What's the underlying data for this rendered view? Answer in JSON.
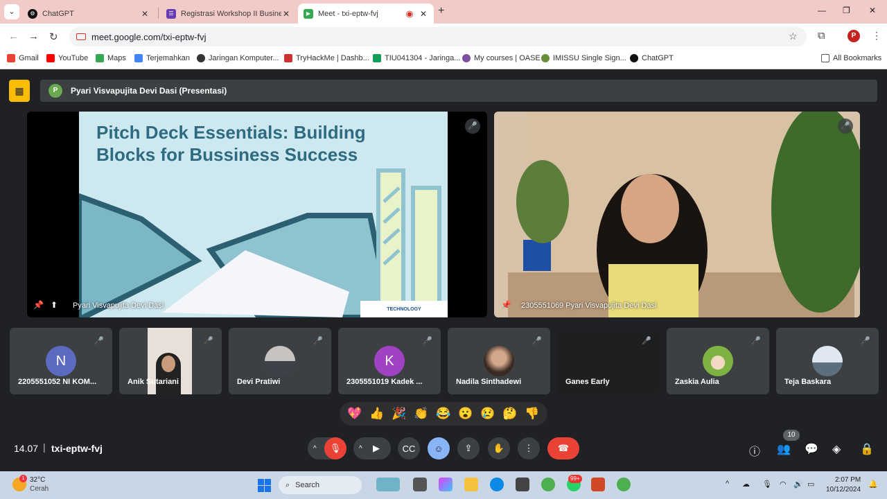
{
  "browser": {
    "tabs": [
      {
        "title": "ChatGPT",
        "active": false
      },
      {
        "title": "Registrasi Workshop II Business",
        "active": false
      },
      {
        "title": "Meet - txi-eptw-fvj",
        "active": true
      }
    ],
    "address": "meet.google.com/txi-eptw-fvj",
    "profile_initial": "P",
    "bookmarks": [
      "Gmail",
      "YouTube",
      "Maps",
      "Terjemahkan",
      "Jaringan Komputer...",
      "TryHackMe | Dashb...",
      "TIU041304 - Jaringa...",
      "My courses | OASE",
      "IMISSU Single Sign...",
      "ChatGPT"
    ],
    "all_bookmarks": "All Bookmarks"
  },
  "meet": {
    "presenting_label": "Pyari Visvapujita Devi Dasi (Presentasi)",
    "presenter_initial": "P",
    "slide": {
      "title": "Pitch Deck Essentials: Building Blocks for Bussiness Success",
      "logo_text": "TECHNOLOGY"
    },
    "main_tile_name": "Pyari Visvapujita Devi Dasi",
    "camera_tile_name": "2305551069 Pyari Visvapujita Devi Dasi",
    "participants": [
      {
        "name": "2205551052 NI KOM...",
        "initial": "N",
        "color": "#5c6bc0"
      },
      {
        "name": "Anik Sutariani",
        "initial": "",
        "color": "#e8e0d8"
      },
      {
        "name": "Devi Pratiwi",
        "initial": "",
        "color": "#8a9aa8"
      },
      {
        "name": "2305551019 Kadek ...",
        "initial": "K",
        "color": "#a142c4"
      },
      {
        "name": "Nadila Sinthadewi",
        "initial": "",
        "color": "#a57d63"
      },
      {
        "name": "Ganes Early",
        "initial": "",
        "color": "#1e1f20"
      },
      {
        "name": "Zaskia Aulia",
        "initial": "",
        "color": "#7cb342"
      },
      {
        "name": "Teja Baskara",
        "initial": "",
        "color": "#b0c4d8"
      }
    ],
    "reactions": [
      "💖",
      "👍",
      "🎉",
      "👏",
      "😂",
      "😮",
      "😢",
      "🤔",
      "👎"
    ],
    "time": "14.07",
    "separator": "|",
    "meeting_code": "txi-eptw-fvj",
    "participant_count": "10"
  },
  "taskbar": {
    "temperature": "32°C",
    "condition": "Cerah",
    "weather_badge": "1",
    "search_placeholder": "Search",
    "whatsapp_badge": "99+",
    "time": "2:07 PM",
    "date": "10/12/2024"
  }
}
